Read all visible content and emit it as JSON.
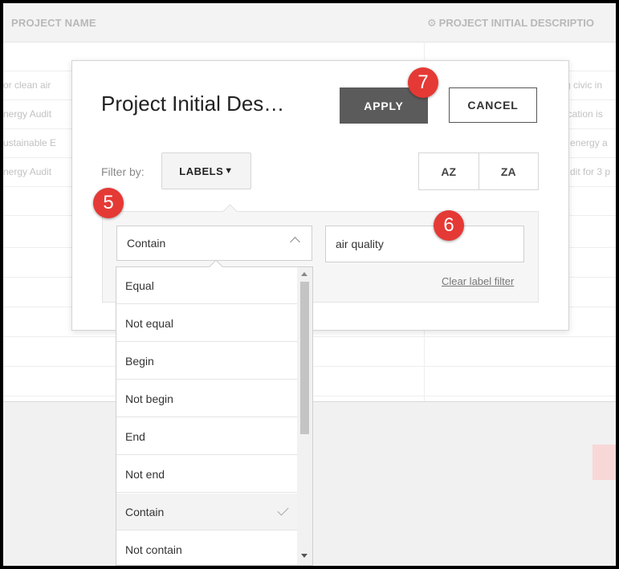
{
  "background": {
    "columns": {
      "project_name": "PROJECT NAME",
      "project_initial_description": "PROJECT INITIAL DESCRIPTIO"
    },
    "rows": [
      {
        "name": "or clean air",
        "desc": "g civic in"
      },
      {
        "name": "nergy Audit",
        "desc": "ication is"
      },
      {
        "name": "ustainable E",
        "desc": "energy a"
      },
      {
        "name": "nergy Audit",
        "desc": "dit for 3 p"
      }
    ]
  },
  "dialog": {
    "title": "Project Initial Des…",
    "apply_label": "APPLY",
    "cancel_label": "CANCEL",
    "filter_by_label": "Filter by:",
    "labels_button": "LABELS",
    "sort": {
      "az": "AZ",
      "za": "ZA"
    },
    "condition_selected": "Contain",
    "value_input": "air quality",
    "clear_label_filter": "Clear label filter"
  },
  "dropdown": {
    "options": [
      "Equal",
      "Not equal",
      "Begin",
      "Not begin",
      "End",
      "Not end",
      "Contain",
      "Not contain"
    ],
    "selected": "Contain"
  },
  "badges": {
    "step5": "5",
    "step6": "6",
    "step7": "7"
  },
  "colors": {
    "badge": "#e53935",
    "apply_bg": "#5b5b5b"
  }
}
